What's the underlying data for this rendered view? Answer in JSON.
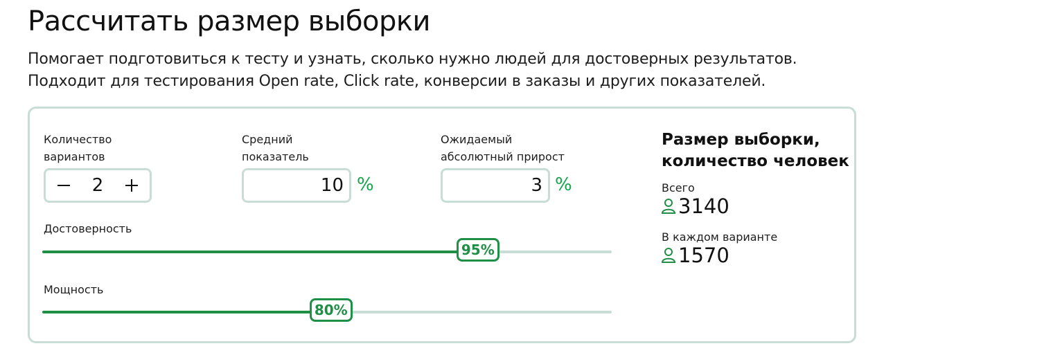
{
  "header": {
    "title": "Рассчитать размер выборки",
    "subtitle_line1": "Помогает подготовиться к тесту и узнать, сколько нужно людей для достоверных результатов.",
    "subtitle_line2": "Подходит для тестирования Open rate, Click rate, конверсии в заказы и других показателей."
  },
  "inputs": {
    "variants": {
      "label_line1": "Количество",
      "label_line2": "вариантов",
      "value": "2",
      "minus_icon": "minus-icon",
      "plus_icon": "plus-icon"
    },
    "average": {
      "label_line1": "Средний",
      "label_line2": "показатель",
      "value": "10",
      "unit": "%"
    },
    "growth": {
      "label_line1": "Ожидаемый",
      "label_line2": "абсолютный прирост",
      "value": "3",
      "unit": "%"
    }
  },
  "sliders": {
    "confidence": {
      "label": "Достоверность",
      "value_label": "95%",
      "fill_percent": 76.5
    },
    "power": {
      "label": "Мощность",
      "value_label": "80%",
      "fill_percent": 50.7
    }
  },
  "result": {
    "title_line1": "Размер выборки,",
    "title_line2": "количество человек",
    "total_label": "Всего",
    "total_value": "3140",
    "per_variant_label": "В каждом варианте",
    "per_variant_value": "1570",
    "icon": "person-icon"
  },
  "colors": {
    "accent": "#1f8f46",
    "unit_green": "#17a34a",
    "border": "#c7ddd6"
  }
}
